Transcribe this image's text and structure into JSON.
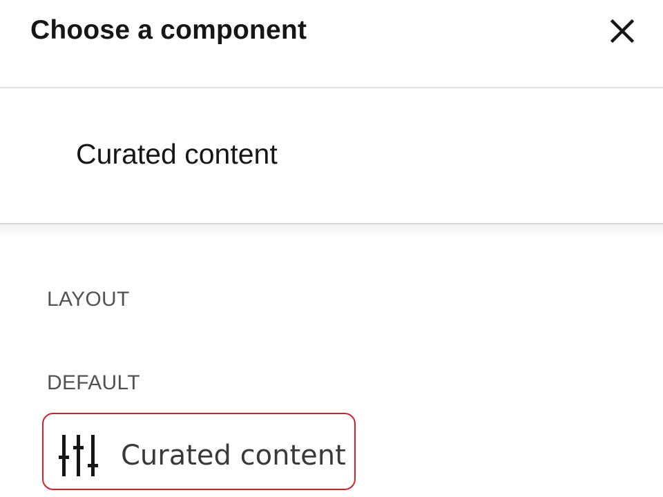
{
  "dialog": {
    "title": "Choose a component",
    "close_icon": "close-icon"
  },
  "search": {
    "value": "Curated content"
  },
  "groups": [
    {
      "label": "LAYOUT"
    },
    {
      "label": "DEFAULT"
    }
  ],
  "components": [
    {
      "label": "Curated content",
      "icon": "sliders-icon",
      "highlight_color": "#da1e28"
    }
  ]
}
